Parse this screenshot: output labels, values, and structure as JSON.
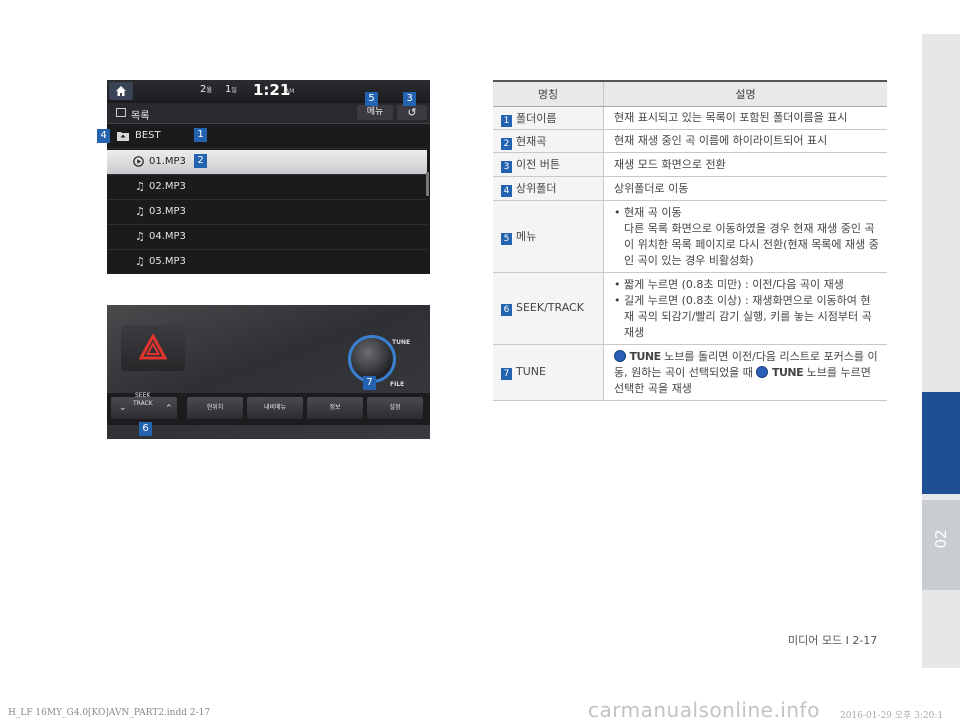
{
  "side_tab": {
    "chapter": "02"
  },
  "screen": {
    "channel_a": "2",
    "channel_a_unit": "월",
    "channel_b": "1",
    "channel_b_unit": "일",
    "time": "1:21",
    "ampm": "AM",
    "list_title": "목록",
    "menu_label": "메뉴",
    "back_symbol": "↺",
    "folder": "BEST",
    "tracks": [
      "01.MP3",
      "02.MP3",
      "03.MP3",
      "04.MP3",
      "05.MP3"
    ],
    "selected_index": 0,
    "badges": {
      "folder_name": "1",
      "current_track": "2",
      "back": "3",
      "parent_folder": "4",
      "menu": "5"
    }
  },
  "dashboard": {
    "tune_label": "TUNE",
    "file_label": "FILE",
    "seek_label_1": "SEEK",
    "seek_label_2": "TRACK",
    "buttons": [
      "현위치",
      "내비메뉴",
      "정보",
      "설정"
    ],
    "badges": {
      "seek": "6",
      "tune": "7"
    }
  },
  "table": {
    "headers": {
      "name": "명칭",
      "desc": "설명"
    },
    "rows": [
      {
        "num": "1",
        "name": "폴더이름",
        "desc": "현재 표시되고 있는 목록이 포함된 폴더이름을 표시"
      },
      {
        "num": "2",
        "name": "현재곡",
        "desc": "현재 재생 중인 곡 이름에 하이라이트되어 표시"
      },
      {
        "num": "3",
        "name": "이전 버튼",
        "desc": "재생 모드 화면으로 전환"
      },
      {
        "num": "4",
        "name": "상위폴더",
        "desc": "상위폴더로 이동"
      },
      {
        "num": "5",
        "name": "메뉴",
        "bullet": "현재 곡 이동",
        "desc": "다른 목록 화면으로 이동하였을 경우 현재 재생 중인 곡이 위치한 목록 페이지로 다시 전환(현재 목록에 재생 중인 곡이 있는 경우 비활성화)"
      },
      {
        "num": "6",
        "name": "SEEK/TRACK",
        "bullet_1": "짧게 누르면 (0.8초 미만) : 이전/다음 곡이 재생",
        "bullet_2": "길게 누르면 (0.8초 이상) : 재생화면으로 이동하여 현재 곡의 되감기/빨리 감기 실행, 키를 놓는 시점부터 곡 재생"
      },
      {
        "num": "7",
        "name": "TUNE",
        "tune_word": "TUNE",
        "desc_1": "노브를 돌리면 이전/다음 리스트로 포커스를 이동, 원하는 곡이 선택되었을 때",
        "desc_2": "노브를 누르면 선택한 곡을 재생"
      }
    ]
  },
  "footer": {
    "page": "미디어 모드 I 2-17"
  },
  "printline": "H_LF 16MY_G4.0[KO]AVN_PART2.indd   2-17",
  "printtime": "2016-01-29   오후 3:20:1",
  "watermark": "carmanualsonline.info"
}
